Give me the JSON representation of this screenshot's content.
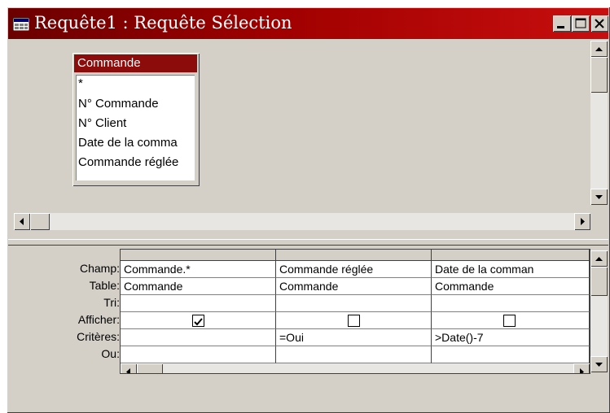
{
  "window": {
    "title": "Requête1 : Requête Sélection",
    "title_color": "#a00000"
  },
  "table_box": {
    "name": "Commande",
    "fields": [
      "*",
      "N° Commande",
      "N° Client",
      "Date de la comma",
      "Commande réglée"
    ]
  },
  "grid": {
    "row_labels": [
      "Champ:",
      "Table:",
      "Tri:",
      "Afficher:",
      "Critères:",
      "Ou:"
    ],
    "columns": [
      {
        "champ": "Commande.*",
        "table": "Commande",
        "tri": "",
        "afficher": true,
        "criteres": "",
        "ou": ""
      },
      {
        "champ": "Commande réglée",
        "table": "Commande",
        "tri": "",
        "afficher": false,
        "criteres": "=Oui",
        "ou": ""
      },
      {
        "champ": "Date de la comman",
        "table": "Commande",
        "tri": "",
        "afficher": false,
        "criteres": ">Date()-7",
        "ou": ""
      }
    ]
  },
  "icons": {
    "title": "query-window-icon",
    "minimize": "minimize-icon",
    "maximize": "maximize-icon",
    "close": "close-icon"
  }
}
